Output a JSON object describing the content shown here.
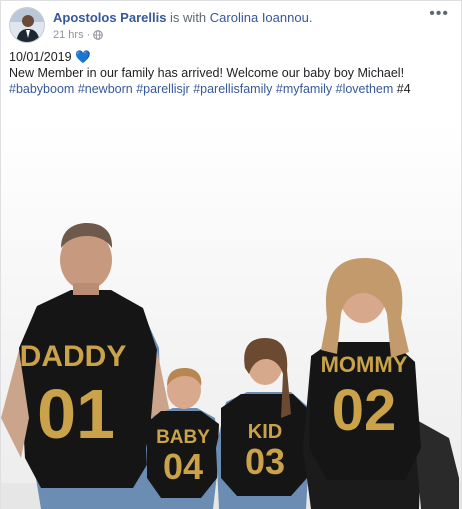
{
  "post": {
    "author": "Apostolos Parellis",
    "with_text": "is with",
    "tagged_person": "Carolina Ioannou.",
    "time": "21 hrs",
    "dot": "·",
    "privacy_icon": "globe-icon",
    "more_icon": "more-options-icon",
    "more_glyph": "•••"
  },
  "content": {
    "date_line": "10/01/2019",
    "heart_emoji": "💙",
    "message": "New Member in our family has arrived! Welcome our baby boy Michael!",
    "hashtags": [
      "#babyboom",
      "#newborn",
      "#parellisjr",
      "#parellisfamily",
      "#myfamily",
      "#lovethem"
    ],
    "suffix": "#4"
  },
  "photo": {
    "shirts": [
      {
        "word": "DADDY",
        "number": "01"
      },
      {
        "word": "BABY",
        "number": "04"
      },
      {
        "word": "KID",
        "number": "03"
      },
      {
        "word": "MOMMY",
        "number": "02"
      }
    ]
  },
  "colors": {
    "link": "#365899",
    "meta": "#90949c",
    "shirt": "#111111",
    "gold": "#c9a24a"
  }
}
